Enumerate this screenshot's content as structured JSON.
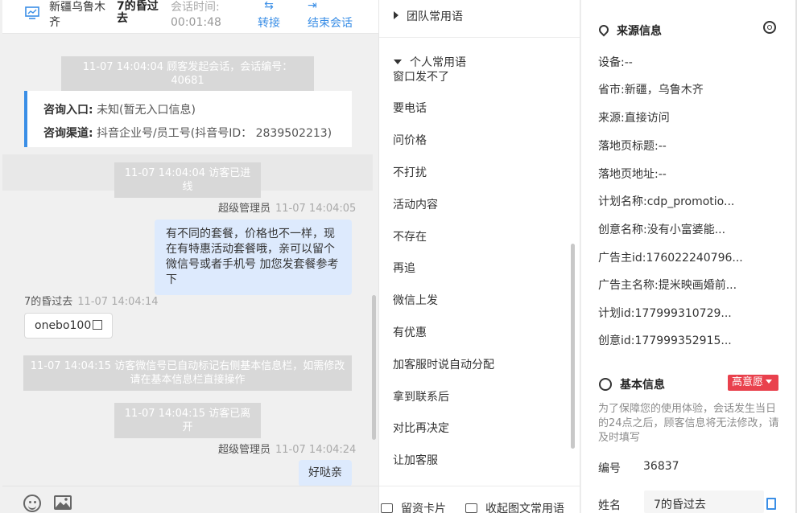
{
  "header": {
    "location": "新疆乌鲁木齐",
    "visitor_name": "7的昏过去",
    "time_label": "会话时间:",
    "time_value": "00:01:48",
    "transfer_label": "转接",
    "end_label": "结束会话",
    "monitor_icon": "monitor-icon",
    "transfer_icon": "transfer-icon",
    "exit_icon": "exit-icon"
  },
  "messages": {
    "sys1": "11-07 14:04:04 顾客发起会话，会话编号：40681",
    "card": {
      "entry_label": "咨询入口:",
      "entry_value": "未知(暂无入口信息)",
      "channel_label": "咨询渠道:",
      "channel_value": "抖音企业号/员工号(抖音号ID： 2839502213)"
    },
    "sys2": "11-07 14:04:04 访客已进线",
    "agent1_name": "超级管理员",
    "agent1_time": "11-07 14:04:05",
    "agent1_text": "有不同的套餐，价格也不一样，现在有特惠活动套餐哦，亲可以留个微信号或者手机号 加您发套餐参考下",
    "visitor_name": "7的昏过去",
    "visitor_time": "11-07 14:04:14",
    "visitor_text": "onebo100",
    "sys3": "11-07 14:04:15 访客微信号已自动标记右侧基本信息栏，如需修改请在基本信息栏直接操作",
    "sys4": "11-07 14:04:15 访客已离开",
    "agent2_name": "超级管理员",
    "agent2_time": "11-07 14:04:24",
    "agent2_text": "好哒亲"
  },
  "phrases": {
    "team_group": "团队常用语",
    "personal_group": "个人常用语",
    "items": [
      "窗口发不了",
      "要电话",
      "问价格",
      "不打扰",
      "活动内容",
      "不存在",
      "再追",
      "微信上发",
      "有优惠",
      "加客服时说自动分配",
      "拿到联系后",
      "对比再决定",
      "让加客服"
    ],
    "save_card": "留资卡片",
    "collapse": "收起图文常用语"
  },
  "source": {
    "title": "来源信息",
    "fields": [
      {
        "label": "设备:",
        "value": "--"
      },
      {
        "label": "省市:",
        "value": "新疆，乌鲁木齐"
      },
      {
        "label": "来源:",
        "value": "直接访问"
      },
      {
        "label": "落地页标题:",
        "value": "--"
      },
      {
        "label": "落地页地址:",
        "value": "--"
      },
      {
        "label": "计划名称:",
        "value": "cdp_promotio..."
      },
      {
        "label": "创意名称:",
        "value": "没有小富婆能..."
      },
      {
        "label": "广告主id:",
        "value": "176022240796..."
      },
      {
        "label": "广告主名称:",
        "value": "提米映画婚前..."
      },
      {
        "label": "计划id:",
        "value": "177999310729..."
      },
      {
        "label": "创意id:",
        "value": "177999352915..."
      }
    ]
  },
  "basic": {
    "title": "基本信息",
    "badge": "高意愿",
    "notice": "为了保障您的使用体验，会话发生当日的24点之后，顾客信息将无法修改，请及时填写",
    "id_label": "编号",
    "id_value": "36837",
    "name_label": "姓名",
    "name_value": "7的昏过去"
  },
  "colors": {
    "accent": "#3a8ee6",
    "badge": "#e9414d",
    "agent_bubble": "#ddeafd"
  }
}
